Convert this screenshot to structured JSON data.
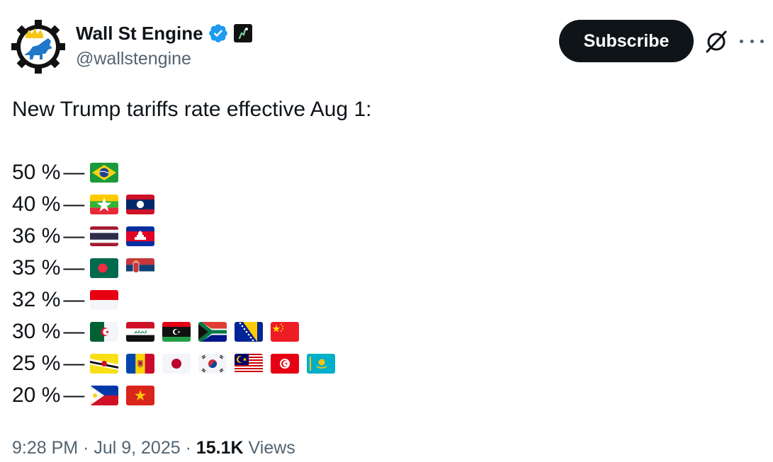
{
  "author": {
    "display_name": "Wall St Engine",
    "handle": "@wallstengine",
    "verified_icon": "verified-badge-icon",
    "affiliate_icon": "affiliate-badge-icon"
  },
  "actions": {
    "subscribe_label": "Subscribe",
    "grok_icon": "grok-icon",
    "more_icon": "more-options-icon"
  },
  "tweet": {
    "text": "New Trump tariffs rate effective Aug 1:",
    "rates": [
      {
        "rate": "50 %",
        "dash": "—",
        "flags": [
          "brazil"
        ]
      },
      {
        "rate": "40 %",
        "dash": "—",
        "flags": [
          "myanmar",
          "laos"
        ]
      },
      {
        "rate": "36 %",
        "dash": "—",
        "flags": [
          "thailand",
          "cambodia"
        ]
      },
      {
        "rate": "35 %",
        "dash": "—",
        "flags": [
          "bangladesh",
          "serbia"
        ]
      },
      {
        "rate": "32 %",
        "dash": "—",
        "flags": [
          "indonesia"
        ]
      },
      {
        "rate": "30 %",
        "dash": "—",
        "flags": [
          "algeria",
          "iraq",
          "libya",
          "south-africa",
          "bosnia-herzegovina",
          "china"
        ]
      },
      {
        "rate": "25 %",
        "dash": "—",
        "flags": [
          "brunei",
          "moldova",
          "japan",
          "south-korea",
          "malaysia",
          "tunisia",
          "kazakhstan"
        ]
      },
      {
        "rate": "20 %",
        "dash": "—",
        "flags": [
          "philippines",
          "vietnam"
        ]
      }
    ]
  },
  "meta": {
    "time": "9:28 PM",
    "sep1": " · ",
    "date": "Jul 9, 2025",
    "sep2": " · ",
    "views_count": "15.1K",
    "views_label": " Views"
  },
  "colors": {
    "text": "#0f1419",
    "secondary": "#536471",
    "verified": "#1d9bf0",
    "button_bg": "#0f1419"
  }
}
